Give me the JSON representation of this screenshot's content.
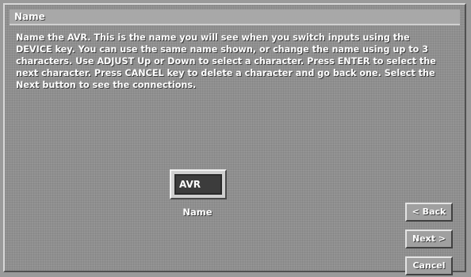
{
  "window": {
    "title": "Name"
  },
  "instructions": "Name the AVR. This is the name you will see when you switch inputs using the DEVICE key. You can use the same name shown, or change the name using up to 3 characters. Use ADJUST Up or Down to select a character. Press ENTER to select the next character. Press CANCEL key to delete a character and go back one. Select the Next button to see the connections.",
  "name_field": {
    "value": "AVR",
    "label": "Name"
  },
  "buttons": {
    "back": "< Back",
    "next": "Next >",
    "cancel": "Cancel"
  }
}
